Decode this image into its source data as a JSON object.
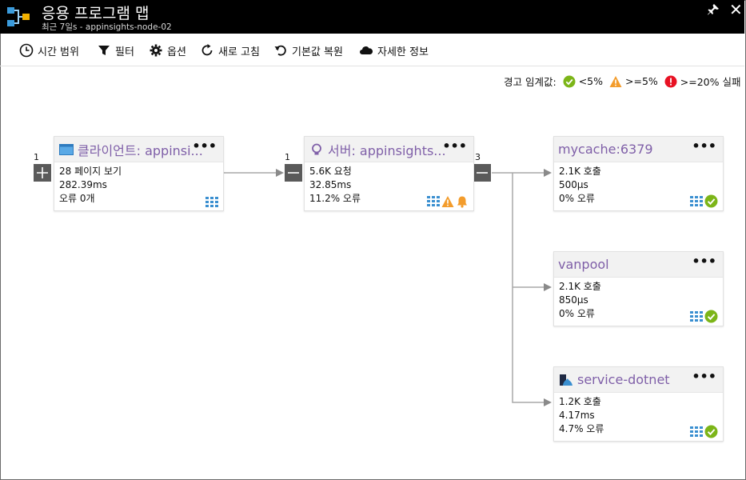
{
  "header": {
    "title": "응용 프로그램 맵",
    "subtitle": "최근 7일s - appinsights-node-02"
  },
  "toolbar": {
    "time_range": "시간 범위",
    "filter": "필터",
    "options": "옵션",
    "refresh": "새로 고침",
    "restore_defaults": "기본값 복원",
    "details": "자세한 정보"
  },
  "legend": {
    "label": "경고 임계값:",
    "ok": "<5%",
    "warn": ">=5%",
    "fail": ">=20% 실패",
    "colors": {
      "ok": "#7cb518",
      "warn": "#f39c2c",
      "fail": "#e81123"
    }
  },
  "nodes": {
    "client": {
      "count": "1",
      "title": "클라이언트: appinsi...",
      "line1": "28 페이지 보기",
      "line2": "282.39ms",
      "line3": "오류 0개",
      "icon": "browser-window-icon"
    },
    "server": {
      "count": "1",
      "title": "서버: appinsights...",
      "line1": "5.6K 요청",
      "line2": "32.85ms",
      "line3": "11.2% 오류",
      "icon": "lightbulb-icon",
      "dep_count": "3"
    },
    "mycache": {
      "title": "mycache:6379",
      "line1": "2.1K 호출",
      "line2": "500µs",
      "line3": "0% 오류"
    },
    "vanpool": {
      "title": "vanpool",
      "line1": "2.1K 호출",
      "line2": "850µs",
      "line3": "0% 오류"
    },
    "dotnet": {
      "title": "service-dotnet",
      "line1": "1.2K 호출",
      "line2": "4.17ms",
      "line3": "4.7% 오류",
      "icon": "service-app-icon"
    }
  },
  "colors": {
    "title_purple": "#7f5fa8",
    "grid_blue": "#3a8fd0",
    "toggle_gray": "#5a5a5a"
  }
}
